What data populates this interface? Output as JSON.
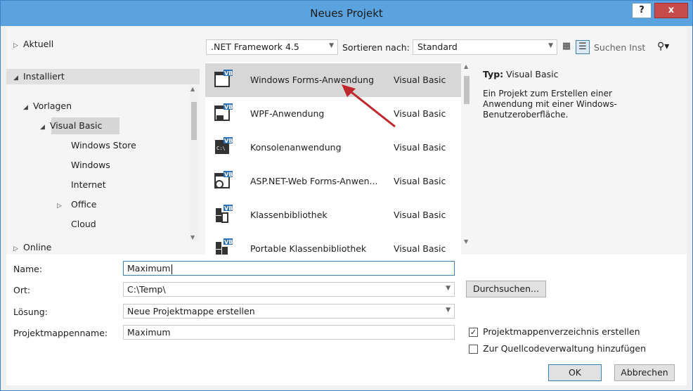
{
  "window": {
    "title": "Neues Projekt",
    "help_label": "?",
    "close_label": "x"
  },
  "tree": {
    "aktuell": "Aktuell",
    "installiert": "Installiert",
    "vorlagen": "Vorlagen",
    "visual_basic": "Visual Basic",
    "windows_store": "Windows Store",
    "windows": "Windows",
    "internet": "Internet",
    "office": "Office",
    "cloud": "Cloud",
    "online": "Online"
  },
  "toolbar": {
    "framework": ".NET Framework 4.5",
    "sort_label": "Sortieren nach:",
    "sort_value": "Standard",
    "search_placeholder": "Suchen Inst"
  },
  "templates": [
    {
      "name": "Windows Forms-Anwendung",
      "lang": "Visual Basic"
    },
    {
      "name": "WPF-Anwendung",
      "lang": "Visual Basic"
    },
    {
      "name": "Konsolenanwendung",
      "lang": "Visual Basic"
    },
    {
      "name": "ASP.NET-Web Forms-Anwen...",
      "lang": "Visual Basic"
    },
    {
      "name": "Klassenbibliothek",
      "lang": "Visual Basic"
    },
    {
      "name": "Portable Klassenbibliothek",
      "lang": "Visual Basic"
    }
  ],
  "details": {
    "typ_label": "Typ:",
    "typ_value": "Visual Basic",
    "description": "Ein Projekt zum Erstellen einer Anwendung mit einer Windows-Benutzeroberfläche."
  },
  "form": {
    "name_label": "Name:",
    "name_value": "Maximum",
    "ort_label": "Ort:",
    "ort_value": "C:\\Temp\\",
    "loesung_label": "Lösung:",
    "loesung_value": "Neue Projektmappe erstellen",
    "pmname_label": "Projektmappenname:",
    "pmname_value": "Maximum",
    "browse_label": "Durchsuchen...",
    "chk1_label": "Projektmappenverzeichnis erstellen",
    "chk2_label": "Zur Quellcodeverwaltung hinzufügen",
    "ok_label": "OK",
    "cancel_label": "Abbrechen"
  },
  "colors": {
    "titlebar": "#5aa3de",
    "selection": "#d7d7d7",
    "annotation_arrow": "#c0282d",
    "vb_badge": "#2a6fb8"
  }
}
